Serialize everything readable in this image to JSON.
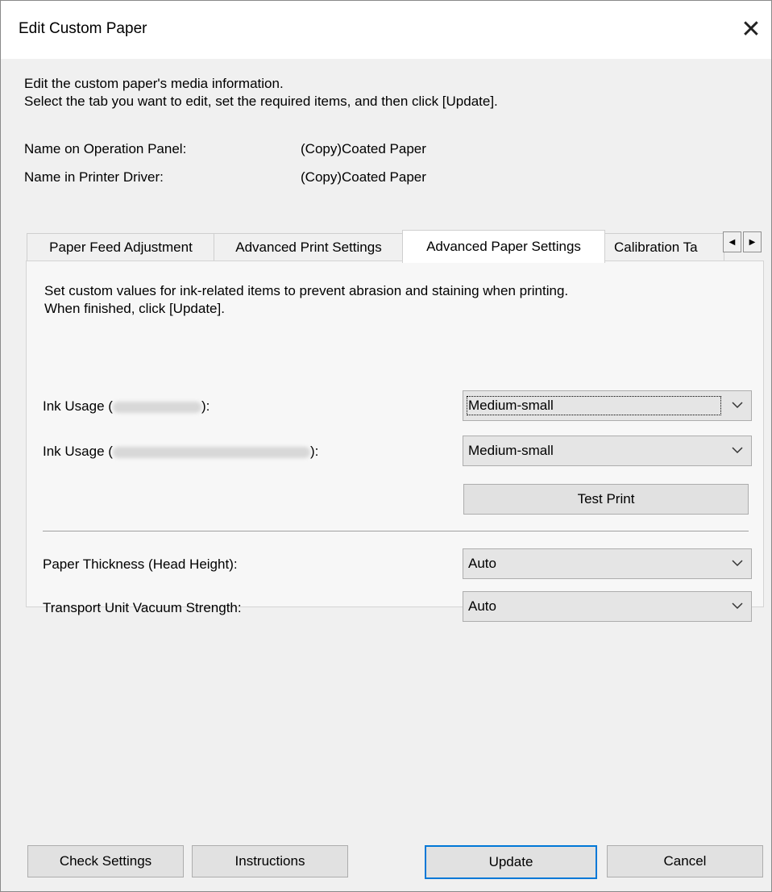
{
  "window": {
    "title": "Edit Custom Paper"
  },
  "intro": {
    "line1": "Edit the custom paper's media information.",
    "line2": "Select the tab you want to edit, set the required items, and then click [Update]."
  },
  "names": {
    "operation_panel_label": "Name on Operation Panel:",
    "operation_panel_value": "(Copy)Coated Paper",
    "printer_driver_label": "Name in Printer Driver:",
    "printer_driver_value": "(Copy)Coated Paper"
  },
  "tabs": [
    {
      "label": "Paper Feed Adjustment"
    },
    {
      "label": "Advanced Print Settings"
    },
    {
      "label": "Advanced Paper Settings"
    },
    {
      "label": "Calibration Ta"
    }
  ],
  "panel": {
    "line1": "Set custom values for ink-related items to prevent abrasion and staining when printing.",
    "line2": "When finished, click [Update].",
    "ink_usage_1": {
      "prefix": "Ink Usage (",
      "suffix": "):",
      "value": "Medium-small"
    },
    "ink_usage_2": {
      "prefix": "Ink Usage (",
      "suffix": "):",
      "value": "Medium-small"
    },
    "test_print": "Test Print",
    "paper_thickness": {
      "label": "Paper Thickness (Head Height):",
      "value": "Auto"
    },
    "vacuum": {
      "label": "Transport Unit Vacuum Strength:",
      "value": "Auto"
    }
  },
  "buttons": {
    "check_settings": "Check Settings",
    "instructions": "Instructions",
    "update": "Update",
    "cancel": "Cancel"
  }
}
